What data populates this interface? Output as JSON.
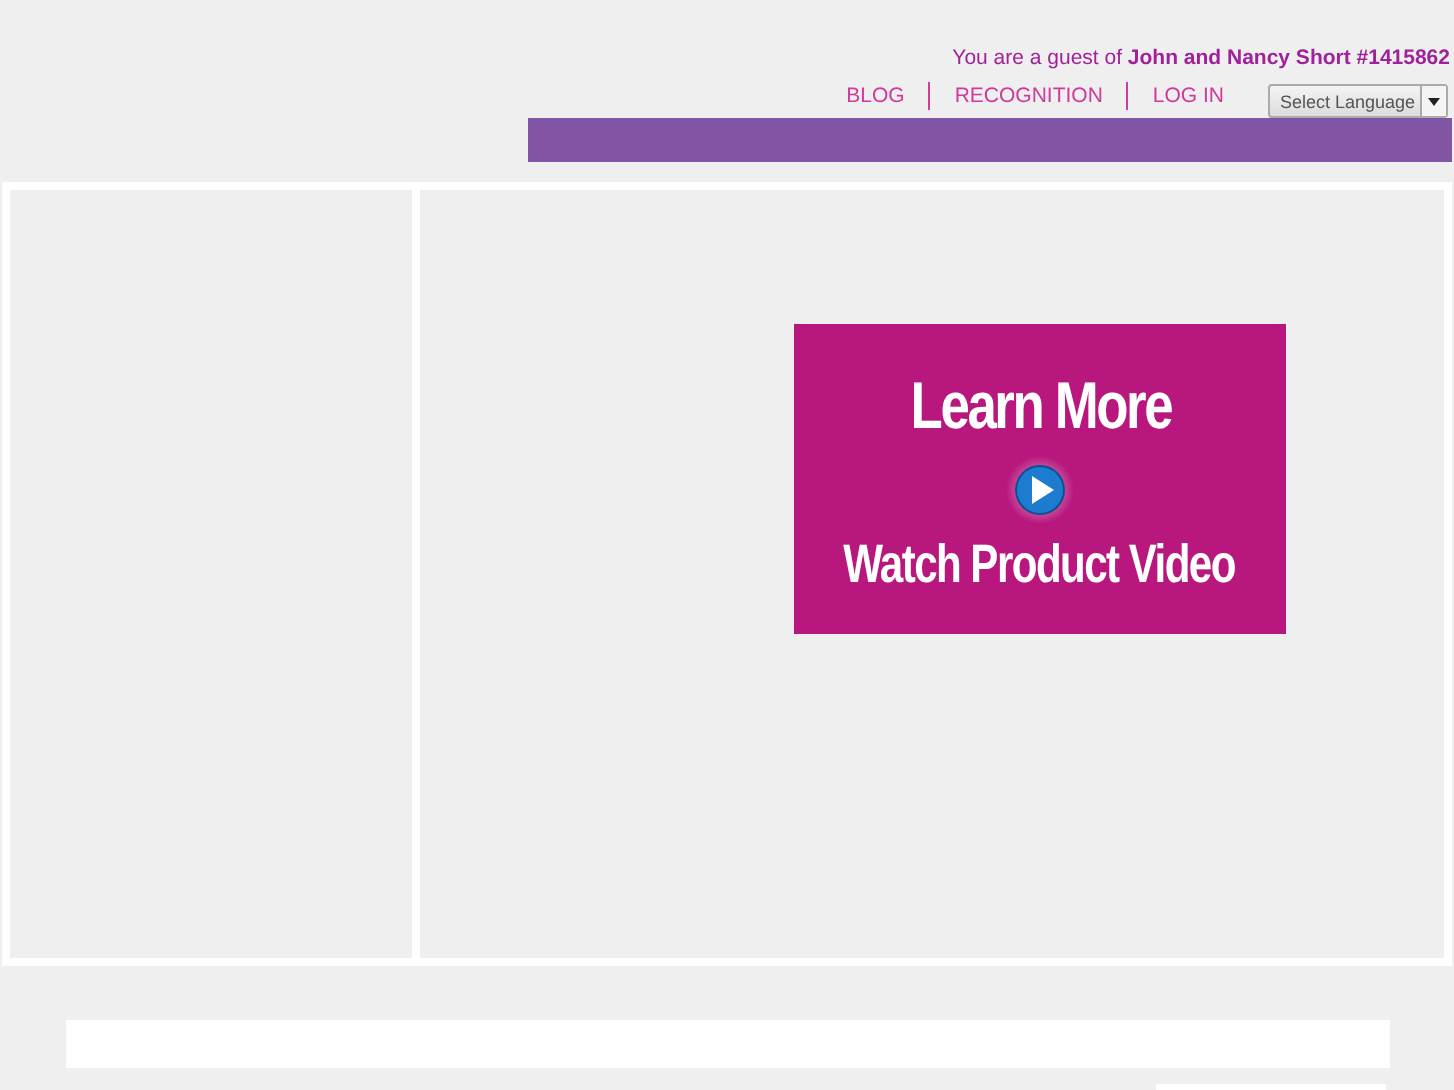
{
  "header": {
    "guest_text": "You are a guest of ",
    "guest_name": "John and Nancy Short #1415862",
    "nav": [
      {
        "label": "BLOG"
      },
      {
        "label": "RECOGNITION"
      },
      {
        "label": "LOG IN"
      }
    ],
    "language_select": {
      "value": "Select Language"
    }
  },
  "promo": {
    "headline": "Learn More",
    "caption": "Watch Product Video"
  }
}
